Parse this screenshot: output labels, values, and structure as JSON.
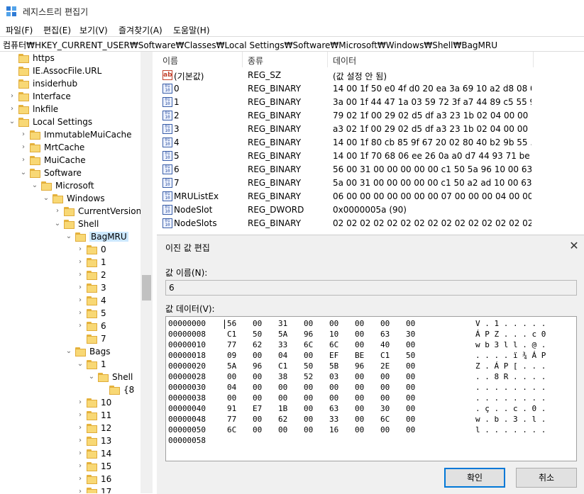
{
  "window": {
    "title": "레지스트리 편집기"
  },
  "menu": [
    "파일(F)",
    "편집(E)",
    "보기(V)",
    "즐겨찾기(A)",
    "도움말(H)"
  ],
  "address": "컴퓨터₩HKEY_CURRENT_USER₩Software₩Classes₩Local Settings₩Software₩Microsoft₩Windows₩Shell₩BagMRU",
  "tree": [
    {
      "label": "https",
      "depth": 2,
      "chev": ""
    },
    {
      "label": "IE.AssocFile.URL",
      "depth": 2,
      "chev": ""
    },
    {
      "label": "insiderhub",
      "depth": 2,
      "chev": ""
    },
    {
      "label": "Interface",
      "depth": 2,
      "chev": ">"
    },
    {
      "label": "lnkfile",
      "depth": 2,
      "chev": ">"
    },
    {
      "label": "Local Settings",
      "depth": 2,
      "chev": "v"
    },
    {
      "label": "ImmutableMuiCache",
      "depth": 3,
      "chev": ">"
    },
    {
      "label": "MrtCache",
      "depth": 3,
      "chev": ">"
    },
    {
      "label": "MuiCache",
      "depth": 3,
      "chev": ">"
    },
    {
      "label": "Software",
      "depth": 3,
      "chev": "v"
    },
    {
      "label": "Microsoft",
      "depth": 4,
      "chev": "v"
    },
    {
      "label": "Windows",
      "depth": 5,
      "chev": "v"
    },
    {
      "label": "CurrentVersion",
      "depth": 6,
      "chev": ">"
    },
    {
      "label": "Shell",
      "depth": 6,
      "chev": "v"
    },
    {
      "label": "BagMRU",
      "depth": 7,
      "chev": "v",
      "selected": true
    },
    {
      "label": "0",
      "depth": 8,
      "chev": ">"
    },
    {
      "label": "1",
      "depth": 8,
      "chev": ">"
    },
    {
      "label": "2",
      "depth": 8,
      "chev": ">"
    },
    {
      "label": "3",
      "depth": 8,
      "chev": ">"
    },
    {
      "label": "4",
      "depth": 8,
      "chev": ">"
    },
    {
      "label": "5",
      "depth": 8,
      "chev": ">"
    },
    {
      "label": "6",
      "depth": 8,
      "chev": ">"
    },
    {
      "label": "7",
      "depth": 8,
      "chev": ""
    },
    {
      "label": "Bags",
      "depth": 7,
      "chev": "v"
    },
    {
      "label": "1",
      "depth": 8,
      "chev": "v"
    },
    {
      "label": "Shell",
      "depth": 9,
      "chev": "v"
    },
    {
      "label": "{8",
      "depth": 10,
      "chev": ""
    },
    {
      "label": "10",
      "depth": 8,
      "chev": ">"
    },
    {
      "label": "11",
      "depth": 8,
      "chev": ">"
    },
    {
      "label": "12",
      "depth": 8,
      "chev": ">"
    },
    {
      "label": "13",
      "depth": 8,
      "chev": ">"
    },
    {
      "label": "14",
      "depth": 8,
      "chev": ">"
    },
    {
      "label": "15",
      "depth": 8,
      "chev": ">"
    },
    {
      "label": "16",
      "depth": 8,
      "chev": ">"
    },
    {
      "label": "17",
      "depth": 8,
      "chev": ">"
    }
  ],
  "list": {
    "headers": [
      "이름",
      "종류",
      "데이터"
    ],
    "rows": [
      {
        "icon": "string-value-icon",
        "name": "(기본값)",
        "type": "REG_SZ",
        "data": "(값 설정 안 됨)"
      },
      {
        "icon": "binary-value-icon",
        "name": "0",
        "type": "REG_BINARY",
        "data": "14 00 1f 50 e0 4f d0 20 ea 3a 69 10 a2 d8 08 0..."
      },
      {
        "icon": "binary-value-icon",
        "name": "1",
        "type": "REG_BINARY",
        "data": "3a 00 1f 44 47 1a 03 59 72 3f a7 44 89 c5 55 9..."
      },
      {
        "icon": "binary-value-icon",
        "name": "2",
        "type": "REG_BINARY",
        "data": "79 02 1f 00 29 02 d5 df a3 23 1b 02 04 00 00 ..."
      },
      {
        "icon": "binary-value-icon",
        "name": "3",
        "type": "REG_BINARY",
        "data": "a3 02 1f 00 29 02 d5 df a3 23 1b 02 04 00 00 ..."
      },
      {
        "icon": "binary-value-icon",
        "name": "4",
        "type": "REG_BINARY",
        "data": "14 00 1f 80 cb 85 9f 67 20 02 80 40 b2 9b 55 ..."
      },
      {
        "icon": "binary-value-icon",
        "name": "5",
        "type": "REG_BINARY",
        "data": "14 00 1f 70 68 06 ee 26 0a a0 d7 44 93 71 be ..."
      },
      {
        "icon": "binary-value-icon",
        "name": "6",
        "type": "REG_BINARY",
        "data": "56 00 31 00 00 00 00 00 c1 50 5a 96 10 00 63..."
      },
      {
        "icon": "binary-value-icon",
        "name": "7",
        "type": "REG_BINARY",
        "data": "5a 00 31 00 00 00 00 00 c1 50 a2 ad 10 00 63 ..."
      },
      {
        "icon": "binary-value-icon",
        "name": "MRUListEx",
        "type": "REG_BINARY",
        "data": "06 00 00 00 00 00 00 00 07 00 00 00 04 00 00 ..."
      },
      {
        "icon": "binary-value-icon",
        "name": "NodeSlot",
        "type": "REG_DWORD",
        "data": "0x0000005a (90)"
      },
      {
        "icon": "binary-value-icon",
        "name": "NodeSlots",
        "type": "REG_BINARY",
        "data": "02 02 02 02 02 02 02 02 02 02 02 02 02 02 02..."
      }
    ]
  },
  "dialog": {
    "title": "이진 값 편집",
    "name_label": "값 이름(N):",
    "name_value": "6",
    "data_label": "값 데이터(V):",
    "hex_rows": [
      {
        "addr": "00000000",
        "bytes": [
          "56",
          "00",
          "31",
          "00",
          "00",
          "00",
          "00",
          "00"
        ],
        "ascii": "V . 1 . . . . ."
      },
      {
        "addr": "00000008",
        "bytes": [
          "C1",
          "50",
          "5A",
          "96",
          "10",
          "00",
          "63",
          "30"
        ],
        "ascii": "Á P Z . . . c 0"
      },
      {
        "addr": "00000010",
        "bytes": [
          "77",
          "62",
          "33",
          "6C",
          "6C",
          "00",
          "40",
          "00"
        ],
        "ascii": "w b 3 l l . @ ."
      },
      {
        "addr": "00000018",
        "bytes": [
          "09",
          "00",
          "04",
          "00",
          "EF",
          "BE",
          "C1",
          "50"
        ],
        "ascii": ". . . . ï ¾ Á P"
      },
      {
        "addr": "00000020",
        "bytes": [
          "5A",
          "96",
          "C1",
          "50",
          "5B",
          "96",
          "2E",
          "00"
        ],
        "ascii": "Z . Á P [ . . ."
      },
      {
        "addr": "00000028",
        "bytes": [
          "00",
          "00",
          "38",
          "52",
          "03",
          "00",
          "00",
          "00"
        ],
        "ascii": ". . 8 R . . . ."
      },
      {
        "addr": "00000030",
        "bytes": [
          "04",
          "00",
          "00",
          "00",
          "00",
          "00",
          "00",
          "00"
        ],
        "ascii": ". . . . . . . ."
      },
      {
        "addr": "00000038",
        "bytes": [
          "00",
          "00",
          "00",
          "00",
          "00",
          "00",
          "00",
          "00"
        ],
        "ascii": ". . . . . . . ."
      },
      {
        "addr": "00000040",
        "bytes": [
          "91",
          "E7",
          "1B",
          "00",
          "63",
          "00",
          "30",
          "00"
        ],
        "ascii": ". ç . . c . 0 ."
      },
      {
        "addr": "00000048",
        "bytes": [
          "77",
          "00",
          "62",
          "00",
          "33",
          "00",
          "6C",
          "00"
        ],
        "ascii": "w . b . 3 . l ."
      },
      {
        "addr": "00000050",
        "bytes": [
          "6C",
          "00",
          "00",
          "00",
          "16",
          "00",
          "00",
          "00"
        ],
        "ascii": "l . . . . . . ."
      },
      {
        "addr": "00000058",
        "bytes": [],
        "ascii": ""
      }
    ],
    "ok_label": "확인",
    "cancel_label": "취소"
  },
  "colors": {
    "selection": "#cce8ff",
    "folder": "#f8d875",
    "accent": "#0078d7"
  }
}
